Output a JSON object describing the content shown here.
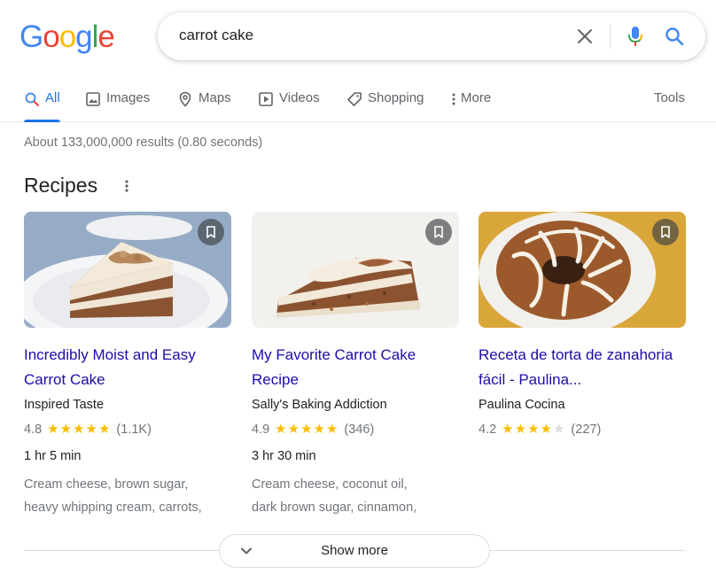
{
  "logo": {
    "letters": [
      "G",
      "o",
      "o",
      "g",
      "l",
      "e"
    ],
    "colors": [
      "#4285f4",
      "#ea4335",
      "#fbbc05",
      "#4285f4",
      "#34a853",
      "#ea4335"
    ]
  },
  "search": {
    "query": "carrot cake",
    "icons": [
      "close-icon",
      "microphone-icon",
      "search-icon"
    ]
  },
  "tabs": [
    {
      "label": "All",
      "icon": "search-icon",
      "active": true
    },
    {
      "label": "Images",
      "icon": "image-icon"
    },
    {
      "label": "Maps",
      "icon": "map-pin-icon"
    },
    {
      "label": "Videos",
      "icon": "video-icon"
    },
    {
      "label": "Shopping",
      "icon": "tag-icon"
    },
    {
      "label": "More",
      "icon": "more-vert-icon"
    }
  ],
  "tools_label": "Tools",
  "result_stats": "About 133,000,000 results (0.80 seconds)",
  "recipes": {
    "heading": "Recipes",
    "cards": [
      {
        "title": "Incredibly Moist and Easy Carrot Cake",
        "source": "Inspired Taste",
        "rating": "4.8",
        "stars": 5,
        "reviews": "(1.1K)",
        "time": "1 hr 5 min",
        "ingredients_1": "Cream cheese, brown sugar,",
        "ingredients_2": "heavy whipping cream, carrots,"
      },
      {
        "title": "My Favorite Carrot Cake Recipe",
        "source": "Sally's Baking Addiction",
        "rating": "4.9",
        "stars": 5,
        "reviews": "(346)",
        "time": "3 hr 30 min",
        "ingredients_1": "Cream cheese, coconut oil,",
        "ingredients_2": "dark brown sugar, cinnamon,"
      },
      {
        "title": "Receta de torta de zanahoria fácil - Paulina...",
        "source": "Paulina Cocina",
        "rating": "4.2",
        "stars": 4,
        "reviews": "(227)",
        "time": "",
        "ingredients_1": "",
        "ingredients_2": ""
      }
    ]
  },
  "show_more_label": "Show more",
  "colors": {
    "link": "#1a0dab",
    "accent": "#1a73e8",
    "star": "#fbbc04",
    "muted": "#70757a"
  }
}
